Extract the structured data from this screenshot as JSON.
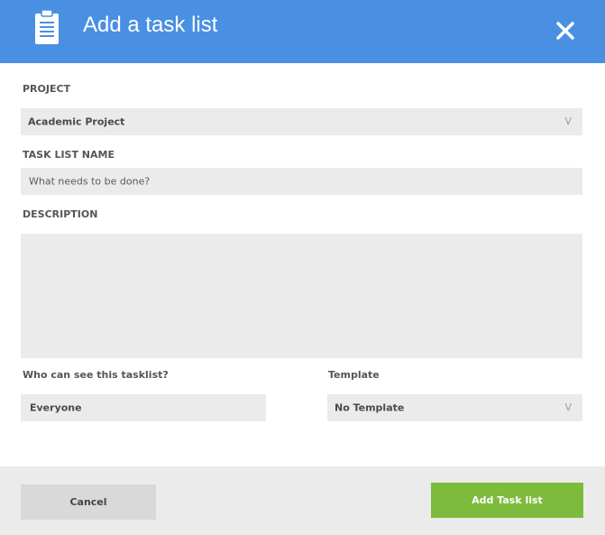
{
  "header": {
    "title": "Add a task list"
  },
  "form": {
    "project_label": "PROJECT",
    "project_value": "Academic Project",
    "task_list_name_label": "TASK LIST NAME",
    "task_list_name_placeholder": "What needs to be done?",
    "description_label": "DESCRIPTION",
    "description_value": "",
    "visibility_label": "Who can see this tasklist?",
    "visibility_value": "Everyone",
    "template_label": "Template",
    "template_value": "No Template",
    "dropdown_chevron": "V"
  },
  "footer": {
    "cancel_label": "Cancel",
    "add_label": "Add Task list"
  },
  "colors": {
    "header_bg": "#4a90e2",
    "primary_button": "#7dbb3c",
    "field_bg": "#ebebeb"
  },
  "icons": {
    "header_icon": "clipboard-icon",
    "close_icon": "close-icon"
  }
}
